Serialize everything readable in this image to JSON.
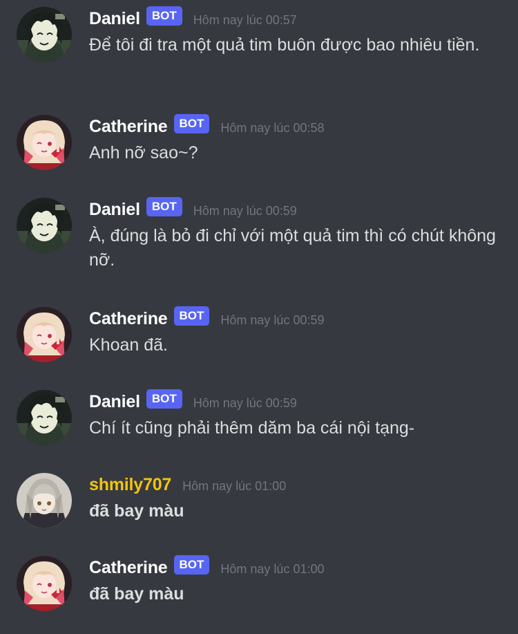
{
  "bot_badge_label": "BOT",
  "avatar_icons": {
    "daniel": "daniel-avatar-icon",
    "catherine": "catherine-avatar-icon",
    "shmily": "shmily707-avatar-icon"
  },
  "colors": {
    "background": "#36393f",
    "username_default": "#ffffff",
    "username_shmily": "#f1c40f",
    "bot_badge": "#5865f2",
    "timestamp": "#72767d",
    "message_text": "#dcddde"
  },
  "messages": [
    {
      "author": "Daniel",
      "is_bot": true,
      "timestamp": "Hôm nay lúc 00:57",
      "text": "Để tôi đi tra một quả tim buôn được bao nhiêu tiền."
    },
    {
      "author": "Catherine",
      "is_bot": true,
      "timestamp": "Hôm nay lúc 00:58",
      "text": "Anh nỡ sao~?"
    },
    {
      "author": "Daniel",
      "is_bot": true,
      "timestamp": "Hôm nay lúc 00:59",
      "text": "À, đúng là bỏ đi chỉ với một quả tim thì có chút không nỡ."
    },
    {
      "author": "Catherine",
      "is_bot": true,
      "timestamp": "Hôm nay lúc 00:59",
      "text": "Khoan đã."
    },
    {
      "author": "Daniel",
      "is_bot": true,
      "timestamp": "Hôm nay lúc 00:59",
      "text": "Chí ít cũng phải thêm dăm ba cái nội tạng-"
    },
    {
      "author": "shmily707",
      "is_bot": false,
      "timestamp": "Hôm nay lúc 01:00",
      "text": "đã bay màu"
    },
    {
      "author": "Catherine",
      "is_bot": true,
      "timestamp": "Hôm nay lúc 01:00",
      "text": "đã bay màu"
    }
  ]
}
